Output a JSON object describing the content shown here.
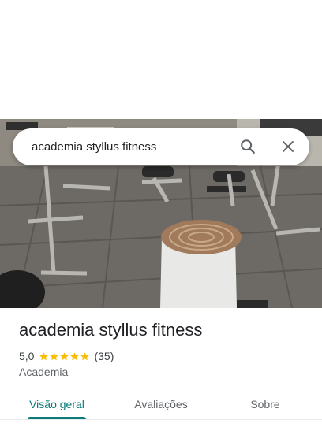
{
  "search": {
    "query": "academia styllus fitness"
  },
  "place": {
    "name": "academia styllus fitness",
    "rating": "5,0",
    "stars": 5,
    "reviews_count": "(35)",
    "category": "Academia"
  },
  "tabs": [
    {
      "label": "Visão geral",
      "active": true
    },
    {
      "label": "Avaliações",
      "active": false
    },
    {
      "label": "Sobre",
      "active": false
    }
  ],
  "colors": {
    "accent": "#0b7b78",
    "star": "#fbbc04",
    "title": "#202124",
    "secondary": "#5f6368"
  },
  "icons": {
    "search": "search-icon",
    "close": "close-icon",
    "star": "star-icon"
  }
}
